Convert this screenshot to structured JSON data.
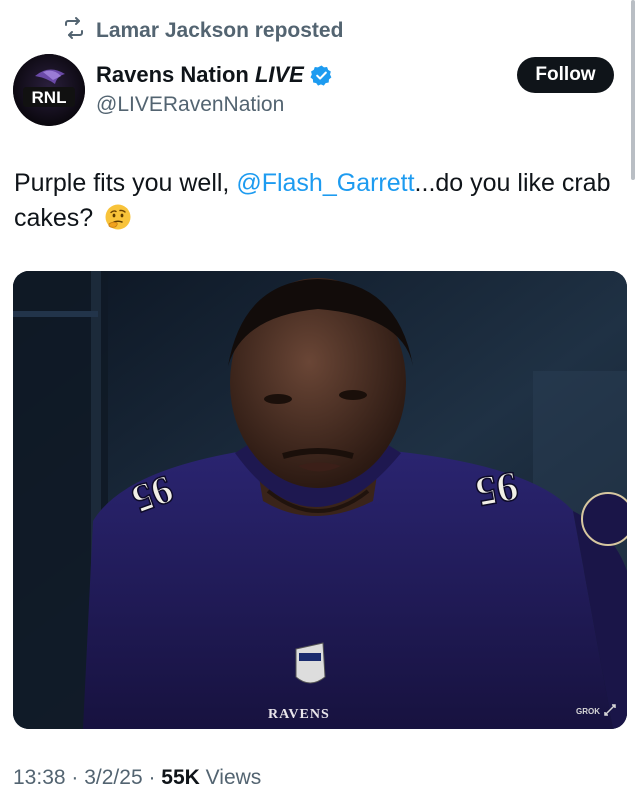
{
  "repost": {
    "label": "Lamar Jackson reposted",
    "icon": "repost-icon"
  },
  "author": {
    "name": "Ravens Nation",
    "name_suffix": "LIVE",
    "handle": "@LIVERavenNation",
    "avatar_text": "RNL",
    "verified_color": "#1d9bf0"
  },
  "follow_button": {
    "label": "Follow"
  },
  "tweet": {
    "text_before": "Purple fits you well, ",
    "mention": "@Flash_Garrett",
    "text_after": "...do you like crab cakes?",
    "emoji": "thinking-face-emoji"
  },
  "media": {
    "jersey_text": "RAVENS",
    "jersey_number": "95",
    "watermark": "GROK"
  },
  "meta": {
    "time": "13:38",
    "separator": " · ",
    "date": "3/2/25",
    "views_count": "55K",
    "views_label": " Views"
  },
  "colors": {
    "accent": "#1d9bf0",
    "text": "#0f1419",
    "secondary": "#536471",
    "button": "#0f1419"
  }
}
